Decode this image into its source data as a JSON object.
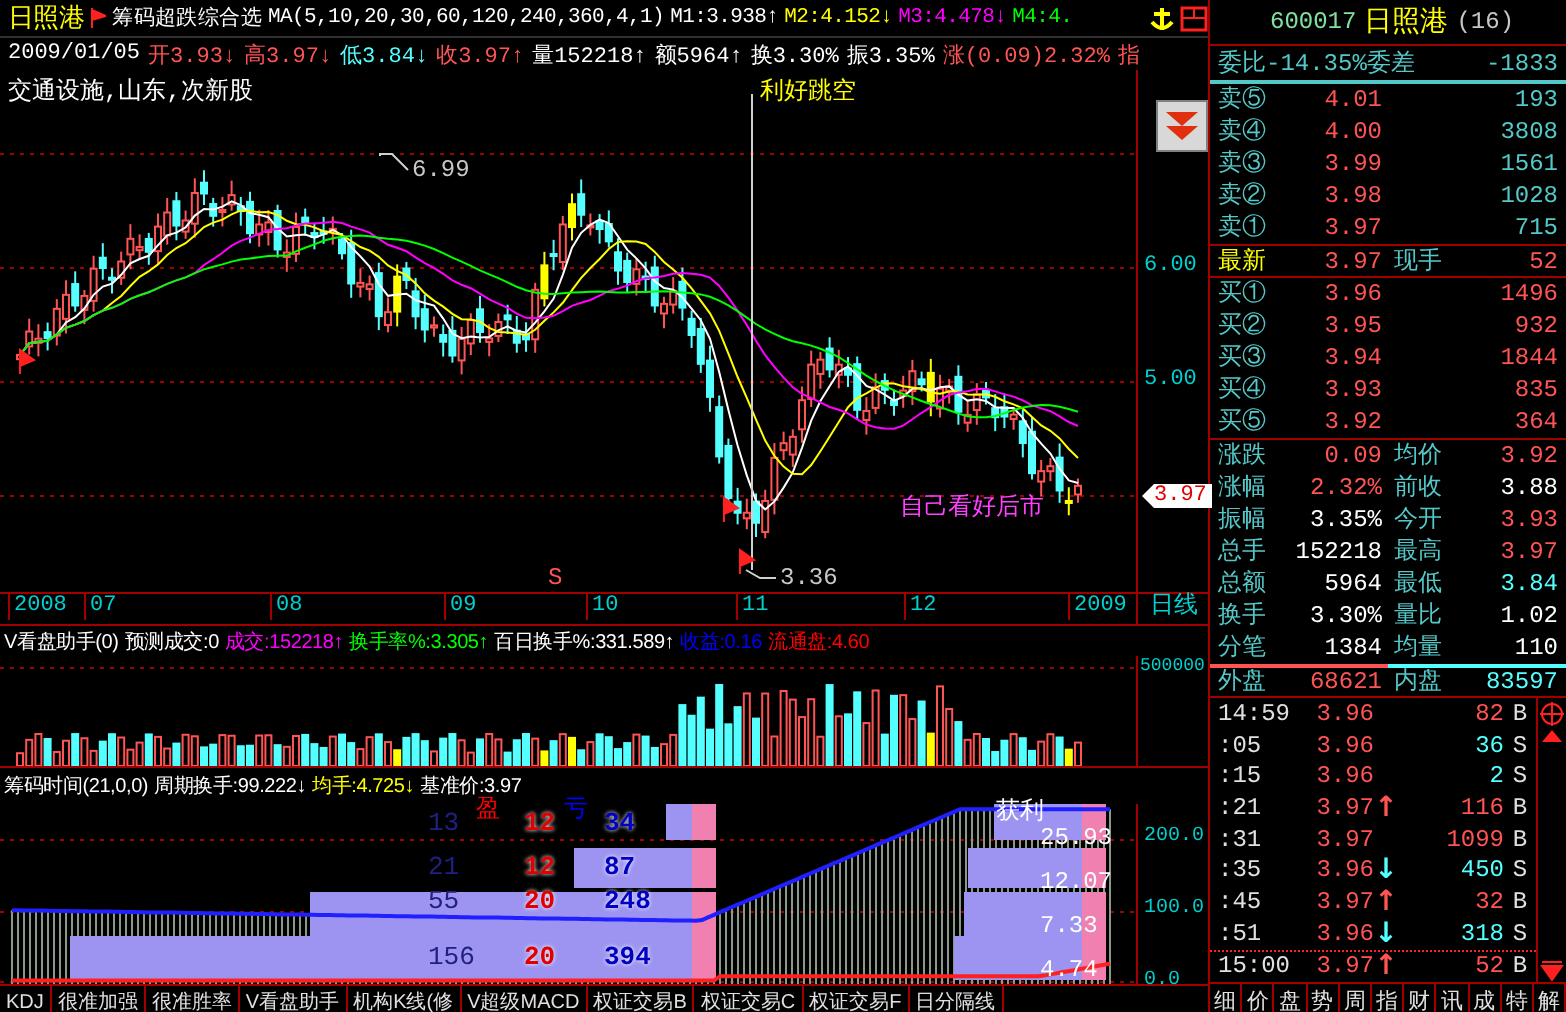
{
  "title_bar": {
    "stock_name": "日照港",
    "formula": "筹码超跌综合选",
    "ma_params": "MA(5,10,20,30,60,120,240,360,4,1)",
    "ma_values": [
      {
        "text": "M1:3.938",
        "arrow": "↑",
        "color": "#ffffff"
      },
      {
        "text": "M2:4.152",
        "arrow": "↓",
        "color": "#ffff00"
      },
      {
        "text": "M3:4.478",
        "arrow": "↓",
        "color": "#ff00ff"
      },
      {
        "text": "M4:4.",
        "color": "#00ff00"
      }
    ]
  },
  "quote_line": {
    "date": "2009/01/05",
    "items": [
      {
        "text": "开3.93",
        "arrow": "↓",
        "color": "#ff5454"
      },
      {
        "text": "高3.97",
        "arrow": "↓",
        "color": "#ff5454"
      },
      {
        "text": "低3.84",
        "arrow": "↓",
        "color": "#54ffff"
      },
      {
        "text": "收3.97",
        "arrow": "↑",
        "color": "#ff5454"
      },
      {
        "text": "量152218",
        "arrow": "↑",
        "color": "#ffffff"
      },
      {
        "text": "额5964",
        "arrow": "↑",
        "color": "#ffffff"
      },
      {
        "text": "换3.30%",
        "color": "#ffffff"
      },
      {
        "text": "振3.35%",
        "color": "#ffffff"
      },
      {
        "text": "涨(0.09)2.32%",
        "color": "#ff5454"
      },
      {
        "text": "指",
        "color": "#ff5454"
      }
    ]
  },
  "price_chart": {
    "sector": "交通设施,山东,次新股",
    "event_label": "利好跳空",
    "high_label": "6.99",
    "low_label": "3.36",
    "note": "自己看好后市",
    "signal": "S",
    "price_ticks": [
      "6.00",
      "5.00"
    ],
    "last_price": "3.97"
  },
  "date_axis": {
    "labels": [
      "2008",
      "07",
      "08",
      "09",
      "10",
      "11",
      "12",
      "2009"
    ],
    "period": "日线"
  },
  "volume_panel": {
    "header": [
      {
        "text": "V看盘助手(0)",
        "color": "#ffffff"
      },
      {
        "text": "预测成交:0",
        "color": "#ffffff"
      },
      {
        "text": "成交:152218↑",
        "color": "#ff00ff"
      },
      {
        "text": "换手率%:3.305↑",
        "color": "#00ff00"
      },
      {
        "text": "百日换手%:331.589↑",
        "color": "#ffffff"
      },
      {
        "text": "收益:0.16",
        "color": "#0000ff"
      },
      {
        "text": "流通盘:4.60",
        "color": "#ff0000"
      }
    ],
    "axis_label": "500000"
  },
  "chip_panel": {
    "header": [
      {
        "text": "筹码时间(21,0,0)",
        "color": "#ffffff"
      },
      {
        "text": "周期换手:99.222↓",
        "color": "#ffffff"
      },
      {
        "text": "均手:4.725↓",
        "color": "#ffff00"
      },
      {
        "text": "基准价:3.97",
        "color": "#ffffff"
      }
    ],
    "column_headers": [
      {
        "text": "盈",
        "color": "#ff0000"
      },
      {
        "text": "亏",
        "color": "#0000ff"
      }
    ],
    "rows": [
      {
        "column_1": "13",
        "column_2": "12",
        "column_3": "34"
      },
      {
        "column_1": "21",
        "column_2": "12",
        "column_3": "87"
      },
      {
        "column_1": "55",
        "column_2": "20",
        "column_3": "248"
      },
      {
        "column_1": "156",
        "column_2": "20",
        "column_3": "394"
      }
    ],
    "profit_label": "获利",
    "profit_values": [
      "25.93",
      "12.07",
      "7.33",
      "4.74"
    ],
    "axis_labels": [
      "200.0",
      "100.0",
      "0.0"
    ]
  },
  "bottom_tabs": [
    "KDJ",
    "很准加强",
    "很准胜率",
    "V看盘助手",
    "机构K线(修",
    "V超级MACD",
    "权证交易B",
    "权证交易C",
    "权证交易F",
    "日分隔线"
  ],
  "quote_panel": {
    "code": "600017",
    "name": "日照港",
    "count": "(16)",
    "ratio_label": "委比",
    "ratio": "-14.35%",
    "diff_label": "委差",
    "diff": "-1833",
    "sells": [
      {
        "label": "卖⑤",
        "price": "4.01",
        "volume": "193"
      },
      {
        "label": "卖④",
        "price": "4.00",
        "volume": "3808"
      },
      {
        "label": "卖③",
        "price": "3.99",
        "volume": "1561"
      },
      {
        "label": "卖②",
        "price": "3.98",
        "volume": "1028"
      },
      {
        "label": "卖①",
        "price": "3.97",
        "volume": "715"
      }
    ],
    "latest": {
      "label": "最新",
      "price": "3.97",
      "hand_label": "现手",
      "hand": "52"
    },
    "buys": [
      {
        "label": "买①",
        "price": "3.96",
        "volume": "1496"
      },
      {
        "label": "买②",
        "price": "3.95",
        "volume": "932"
      },
      {
        "label": "买③",
        "price": "3.94",
        "volume": "1844"
      },
      {
        "label": "买④",
        "price": "3.93",
        "volume": "835"
      },
      {
        "label": "买⑤",
        "price": "3.92",
        "volume": "364"
      }
    ],
    "stats": [
      {
        "cells": [
          {
            "label": "涨跌",
            "value": "0.09",
            "color": "#ff5454"
          },
          {
            "label": "均价",
            "value": "3.92",
            "color": "#ff5454"
          }
        ]
      },
      {
        "cells": [
          {
            "label": "涨幅",
            "value": "2.32%",
            "color": "#ff5454"
          },
          {
            "label": "前收",
            "value": "3.88",
            "color": "#ffffff"
          }
        ]
      },
      {
        "cells": [
          {
            "label": "振幅",
            "value": "3.35%",
            "color": "#ffffff"
          },
          {
            "label": "今开",
            "value": "3.93",
            "color": "#ff5454"
          }
        ]
      },
      {
        "cells": [
          {
            "label": "总手",
            "value": "152218",
            "color": "#ffffff"
          },
          {
            "label": "最高",
            "value": "3.97",
            "color": "#ff5454"
          }
        ]
      },
      {
        "cells": [
          {
            "label": "总额",
            "value": "5964",
            "color": "#ffffff"
          },
          {
            "label": "最低",
            "value": "3.84",
            "color": "#54ffff"
          }
        ]
      },
      {
        "cells": [
          {
            "label": "换手",
            "value": "3.30%",
            "color": "#ffffff"
          },
          {
            "label": "量比",
            "value": "1.02",
            "color": "#ffffff"
          }
        ]
      },
      {
        "cells": [
          {
            "label": "分笔",
            "value": "1384",
            "color": "#ffffff"
          },
          {
            "label": "均量",
            "value": "110",
            "color": "#ffffff"
          }
        ]
      },
      {
        "cells": [
          {
            "label": "外盘",
            "value": "68621",
            "color": "#ff5454"
          },
          {
            "label": "内盘",
            "value": "83597",
            "color": "#54ffff"
          }
        ]
      }
    ],
    "ticks": [
      {
        "time": "14:59",
        "price": "3.96",
        "volume": "82",
        "side": "B",
        "buy": true
      },
      {
        "time": ":05",
        "price": "3.96",
        "volume": "36",
        "side": "S",
        "buy": false
      },
      {
        "time": ":15",
        "price": "3.96",
        "volume": "2",
        "side": "S",
        "buy": false
      },
      {
        "time": ":21",
        "price": "3.97",
        "arrow": {
          "text": "↑",
          "color": "#ff5454"
        },
        "volume": "116",
        "side": "B",
        "buy": true
      },
      {
        "time": ":31",
        "price": "3.97",
        "volume": "1099",
        "side": "B",
        "buy": true
      },
      {
        "time": ":35",
        "price": "3.96",
        "arrow": {
          "text": "↓",
          "color": "#54ffff"
        },
        "volume": "450",
        "side": "S",
        "buy": false
      },
      {
        "time": ":45",
        "price": "3.97",
        "arrow": {
          "text": "↑",
          "color": "#ff5454"
        },
        "volume": "32",
        "side": "B",
        "buy": true
      },
      {
        "time": ":51",
        "price": "3.96",
        "arrow": {
          "text": "↓",
          "color": "#54ffff"
        },
        "volume": "318",
        "side": "S",
        "buy": false
      },
      {
        "time": "15:00",
        "price": "3.97",
        "arrow": {
          "text": "↑",
          "color": "#ff5454"
        },
        "volume": "52",
        "side": "B",
        "buy": true
      }
    ],
    "tabs": [
      "细",
      "价",
      "盘",
      "势",
      "周",
      "指",
      "财",
      "讯",
      "成",
      "特",
      "解"
    ]
  }
}
